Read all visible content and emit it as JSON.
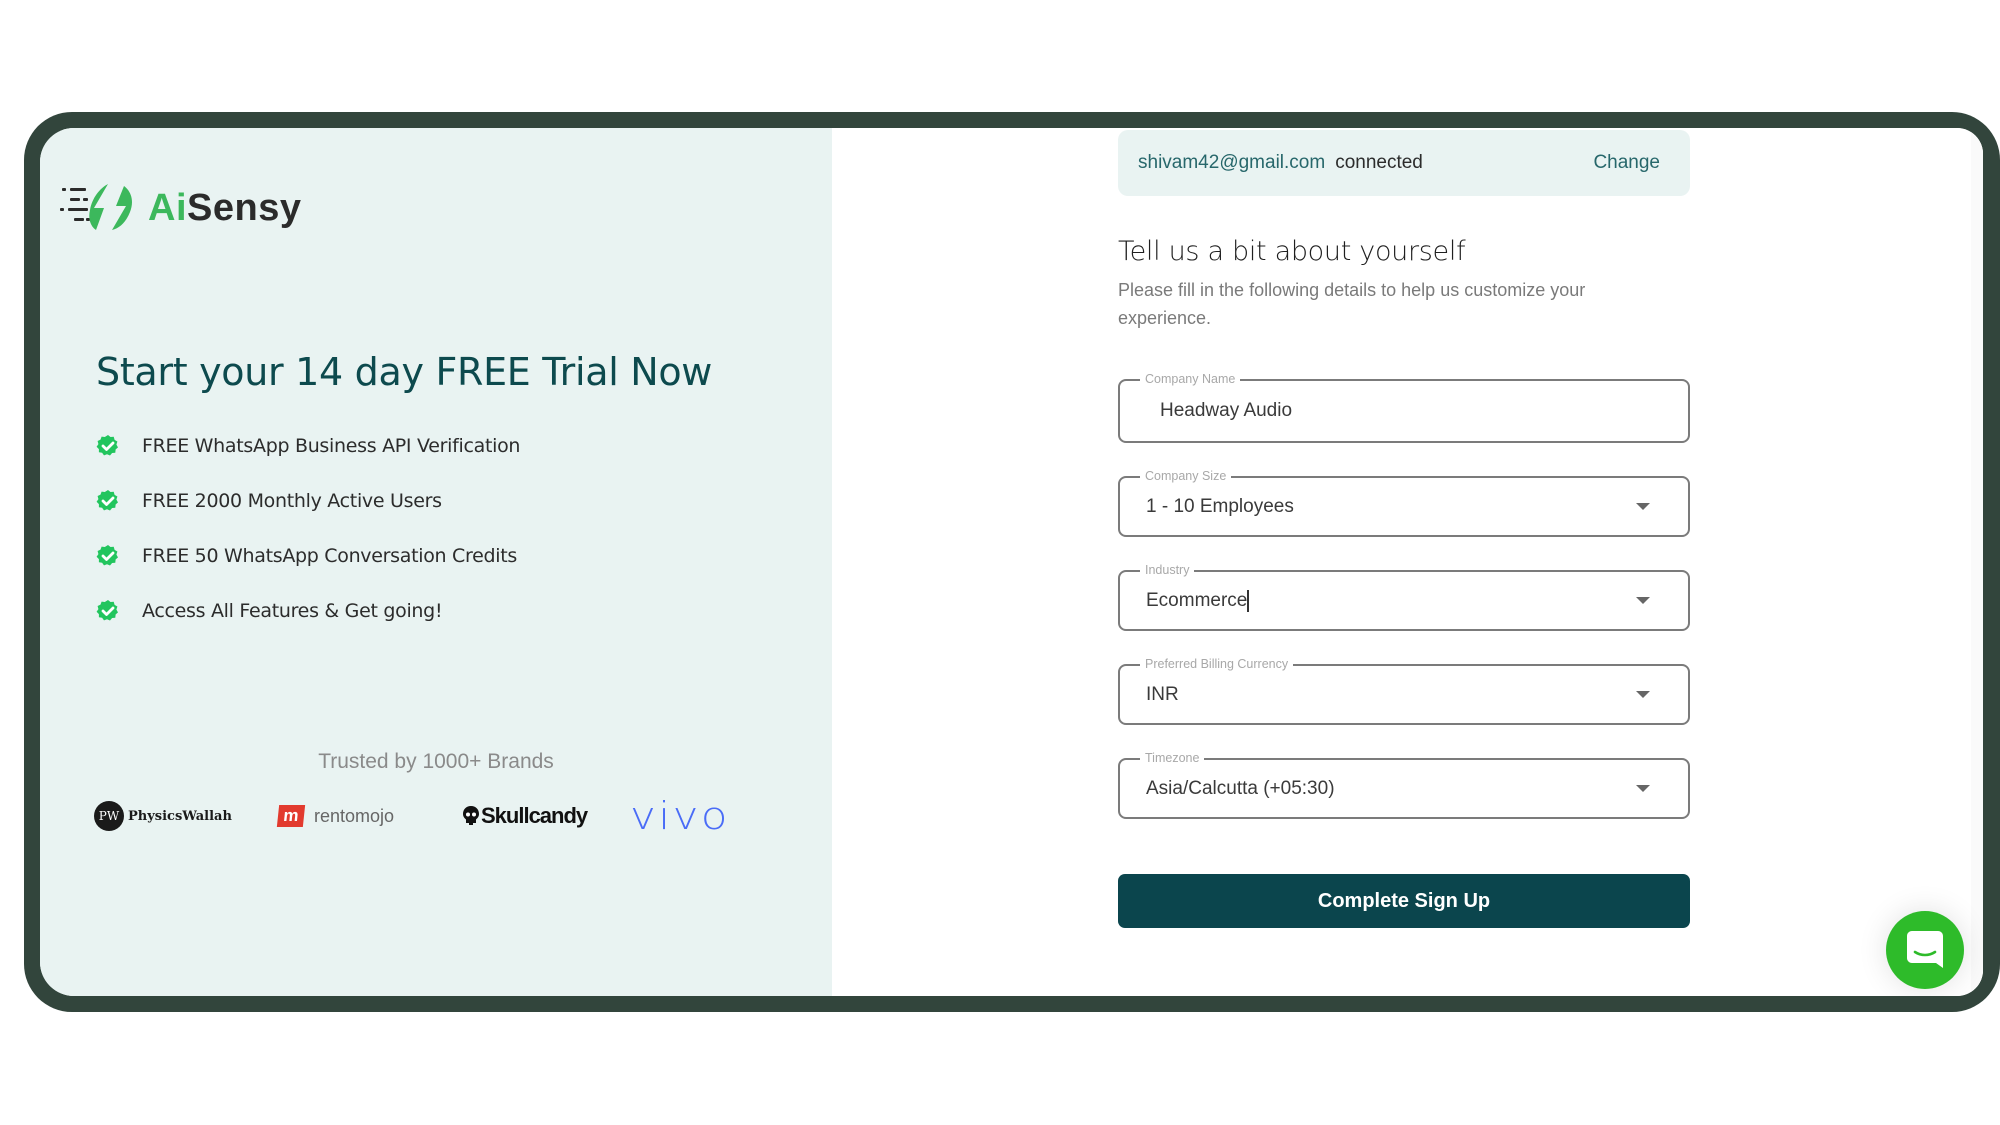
{
  "brand": {
    "logo_ai": "Ai",
    "logo_sensy": "Sensy",
    "accent_green": "#3cb85c",
    "primary_dark": "#0b454d"
  },
  "left_panel": {
    "heading": "Start your 14 day FREE Trial Now",
    "features": [
      {
        "icon": "check-circle-icon",
        "label": "FREE WhatsApp Business API Verification"
      },
      {
        "icon": "check-circle-icon",
        "label": "FREE 2000 Monthly Active Users"
      },
      {
        "icon": "check-circle-icon",
        "label": "FREE 50 WhatsApp Conversation Credits"
      },
      {
        "icon": "check-circle-icon",
        "label": "Access All Features & Get going!"
      }
    ],
    "trusted_text": "Trusted by 1000+ Brands",
    "brands": [
      {
        "name": "PhysicsWallah",
        "badge": "PW"
      },
      {
        "name": "rentomojo",
        "badge": "m"
      },
      {
        "name": "Skullcandy"
      },
      {
        "name": "vivo"
      }
    ]
  },
  "account": {
    "email": "shivam42@gmail.com",
    "status": "connected",
    "change_label": "Change"
  },
  "form": {
    "title": "Tell us a bit about yourself",
    "subtitle": "Please fill in the following details to help us customize your experience.",
    "fields": [
      {
        "label": "Company Name",
        "value": "Headway Audio",
        "type": "text"
      },
      {
        "label": "Company Size",
        "value": "1 - 10 Employees",
        "type": "select"
      },
      {
        "label": "Industry",
        "value": "Ecommerce",
        "type": "select"
      },
      {
        "label": "Preferred Billing Currency",
        "value": "INR",
        "type": "select"
      },
      {
        "label": "Timezone",
        "value": "Asia/Calcutta (+05:30)",
        "type": "select"
      }
    ],
    "submit_label": "Complete Sign Up"
  },
  "chat_widget": {
    "icon": "chat-bubble-icon"
  }
}
